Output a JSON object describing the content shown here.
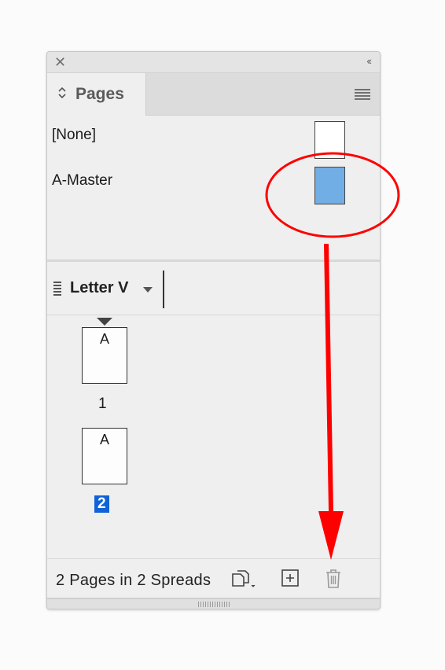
{
  "panel": {
    "close_glyph": "✕",
    "collapse_glyph": "‹‹",
    "tab_label": "Pages",
    "tab_icon": "sort-updown-icon",
    "menu_icon": "hamburger-menu-icon"
  },
  "masters": [
    {
      "label": "[None]",
      "thumb_color": "#ffffff"
    },
    {
      "label": "A-Master",
      "thumb_color": "#72aee6"
    }
  ],
  "toolbar": {
    "page_size_label": "Letter V"
  },
  "pages": [
    {
      "master": "A",
      "number": "1",
      "selected": false
    },
    {
      "master": "A",
      "number": "2",
      "selected": true
    }
  ],
  "status": {
    "text": "2 Pages in 2 Spreads"
  },
  "colors": {
    "annotation_red": "#ff0000",
    "selection_blue": "#0f63d6",
    "master_thumb_blue": "#72aee6"
  }
}
